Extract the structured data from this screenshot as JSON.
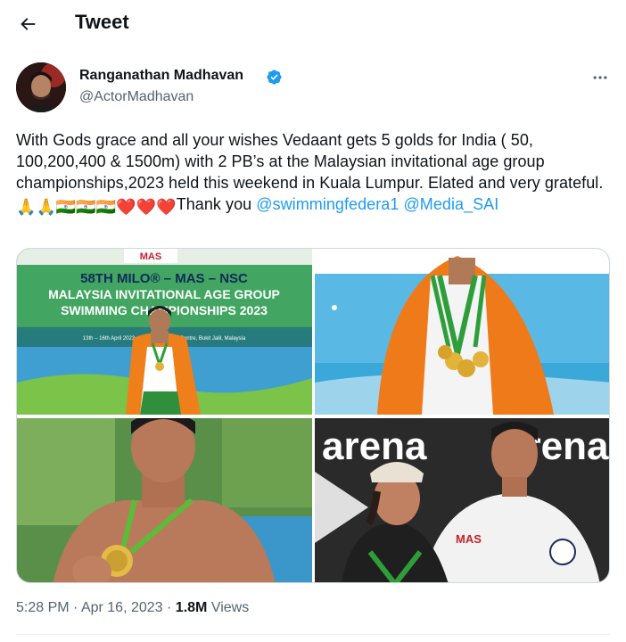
{
  "header": {
    "title": "Tweet",
    "back_icon": "arrow-left-icon"
  },
  "author": {
    "name": "Ranganathan Madhavan",
    "handle": "@ActorMadhavan",
    "verified_color": "#1d9bf0"
  },
  "tweet": {
    "text_before": "With Gods grace and all your wishes Vedaant gets 5 golds for India ( 50, 100,200,400 & 1500m) with 2 PB’s at the Malaysian invitational age group championships,2023 held this weekend in Kuala Lumpur. Elated and very grateful. ",
    "emojis": "🙏🙏🇮🇳🇮🇳🇮🇳❤️❤️❤️",
    "text_after": "Thank you ",
    "mention_1": "@swimmingfedera1",
    "mention_2": "@Media_SAI"
  },
  "media": {
    "photo_1": {
      "banner_line_1": "58TH MILO® – MAS – NSC",
      "banner_line_2": "MALAYSIA INVITATIONAL AGE GROUP",
      "banner_line_3": "SWIMMING CHAMPIONSHIPS 2023",
      "banner_dates": "13th – 16th April 2023 · National Aquatic Centre, Bukit Jalil, Malaysia",
      "logo_text": "MAS"
    },
    "photo_3_brand": "arena",
    "photo_4_brand": "arena",
    "photo_4_shirt_logo": "MAS"
  },
  "meta": {
    "time": "5:28 PM",
    "separator": "·",
    "date": "Apr 16, 2023",
    "views_count": "1.8M",
    "views_label": "Views"
  },
  "colors": {
    "accent": "#1d9bf0",
    "secondary_text": "#536471"
  }
}
